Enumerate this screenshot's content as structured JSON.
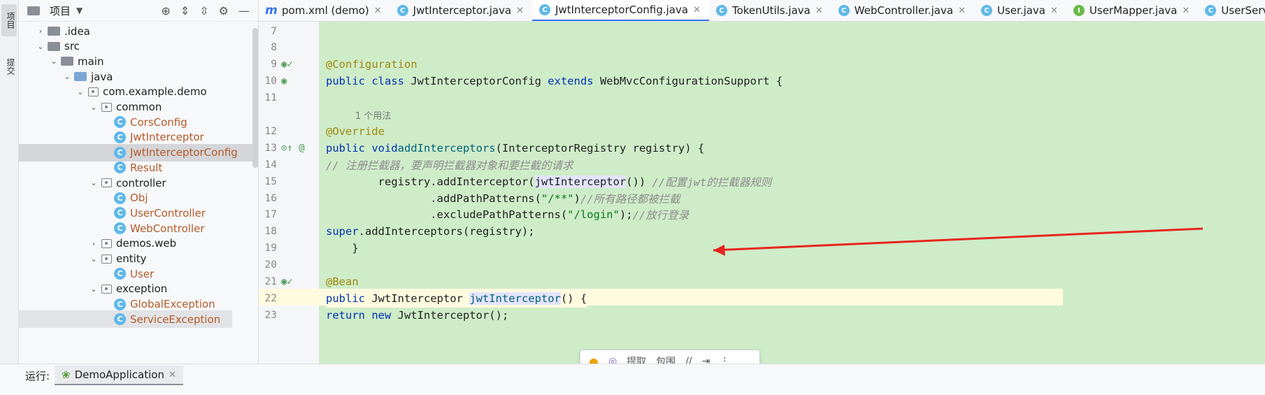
{
  "app": {
    "left_strip": [
      "项目",
      "提交"
    ]
  },
  "project_panel": {
    "title": "项目",
    "tree": [
      {
        "label": ".idea",
        "type": "folder",
        "depth": 1,
        "chev": "›"
      },
      {
        "label": "src",
        "type": "folder",
        "depth": 1,
        "chev": "⌄"
      },
      {
        "label": "main",
        "type": "folder",
        "depth": 2,
        "chev": "⌄"
      },
      {
        "label": "java",
        "type": "folder-blue",
        "depth": 3,
        "chev": "⌄"
      },
      {
        "label": "com.example.demo",
        "type": "package",
        "depth": 4,
        "chev": "⌄"
      },
      {
        "label": "common",
        "type": "package",
        "depth": 5,
        "chev": "⌄"
      },
      {
        "label": "CorsConfig",
        "type": "class",
        "depth": 6
      },
      {
        "label": "JwtInterceptor",
        "type": "class",
        "depth": 6
      },
      {
        "label": "JwtInterceptorConfig",
        "type": "class",
        "depth": 6,
        "selected": true
      },
      {
        "label": "Result",
        "type": "class",
        "depth": 6
      },
      {
        "label": "controller",
        "type": "package",
        "depth": 5,
        "chev": "⌄"
      },
      {
        "label": "Obj",
        "type": "class",
        "depth": 6
      },
      {
        "label": "UserController",
        "type": "class",
        "depth": 6
      },
      {
        "label": "WebController",
        "type": "class",
        "depth": 6
      },
      {
        "label": "demos.web",
        "type": "package",
        "depth": 5,
        "chev": "›"
      },
      {
        "label": "entity",
        "type": "package",
        "depth": 5,
        "chev": "⌄"
      },
      {
        "label": "User",
        "type": "class",
        "depth": 6
      },
      {
        "label": "exception",
        "type": "package",
        "depth": 5,
        "chev": "⌄"
      },
      {
        "label": "GlobalException",
        "type": "class",
        "depth": 6
      },
      {
        "label": "ServiceException",
        "type": "class",
        "depth": 6,
        "partial": true
      }
    ]
  },
  "tabs": [
    {
      "label": "pom.xml (demo)",
      "icon": "m"
    },
    {
      "label": "JwtInterceptor.java",
      "icon": "c"
    },
    {
      "label": "JwtInterceptorConfig.java",
      "icon": "c",
      "active": true
    },
    {
      "label": "TokenUtils.java",
      "icon": "c"
    },
    {
      "label": "WebController.java",
      "icon": "c"
    },
    {
      "label": "User.java",
      "icon": "c"
    },
    {
      "label": "UserMapper.java",
      "icon": "i"
    },
    {
      "label": "UserServ",
      "icon": "c"
    }
  ],
  "editor": {
    "usage_hint": "1 个用法",
    "lines": [
      {
        "n": "7",
        "html": ""
      },
      {
        "n": "8",
        "html": ""
      },
      {
        "n": "9",
        "html": "<span class='an'>@Configuration</span>"
      },
      {
        "n": "10",
        "html": "<span class='kw'>public class</span> JwtInterceptorConfig <span class='kw'>extends</span> WebMvcConfigurationSupport {"
      },
      {
        "n": "11",
        "html": ""
      },
      {
        "n": "",
        "usage": true
      },
      {
        "n": "12",
        "html": "    <span class='an'>@Override</span>"
      },
      {
        "n": "13",
        "html": "    <span class='kw'>public void</span> <span class='fn'>addInterceptors</span>(InterceptorRegistry registry) {"
      },
      {
        "n": "14",
        "html": "        <span class='cm'>// 注册拦截器，要声明拦截器对象和要拦截的请求</span>"
      },
      {
        "n": "15",
        "html": "        registry.addInterceptor(<span class='hl'>jwtInterceptor</span>()) <span class='cm'>//配置jwt的拦截器规则</span>"
      },
      {
        "n": "16",
        "html": "                .addPathPatterns(<span class='str'>\"/**\"</span>)<span class='cm'>//所有路径都被拦截</span>"
      },
      {
        "n": "17",
        "html": "                .excludePathPatterns(<span class='str'>\"/login\"</span>);<span class='cm'>//放行登录</span>"
      },
      {
        "n": "18",
        "html": "        <span class='kw'>super</span>.addInterceptors(registry);"
      },
      {
        "n": "19",
        "html": "    }"
      },
      {
        "n": "20",
        "html": ""
      },
      {
        "n": "21",
        "html": "    <span class='an'>@Bean</span>"
      },
      {
        "n": "22",
        "html": "    <span class='kw'>public</span> JwtInterceptor <span class='fn hl'>jwtInterceptor</span>() {",
        "cur": true
      },
      {
        "n": "23",
        "html": "        <span class='kw'>return new</span> JwtInterceptor();"
      }
    ]
  },
  "popup": {
    "extract": "提取",
    "wrap": "包围"
  },
  "bottom": {
    "run_label": "运行:",
    "run_tab": "DemoApplication"
  },
  "colors": {
    "arrow": "#e8251f",
    "accent": "#3574f0",
    "class_icon": "#5fb8e8"
  }
}
